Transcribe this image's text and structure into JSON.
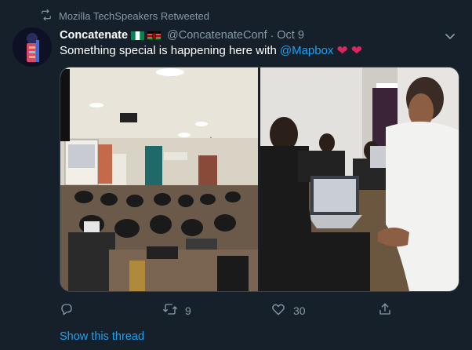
{
  "retweet": {
    "text": "Mozilla TechSpeakers Retweeted",
    "icon": "retweet-icon"
  },
  "author": {
    "name": "Concatenate",
    "flags": [
      "nigeria-flag",
      "kenya-flag"
    ],
    "handle": "@ConcatenateConf",
    "separator": "·",
    "date": "Oct 9"
  },
  "tweet": {
    "text": "Something special is happening here with",
    "mention": "@Mapbox",
    "hearts": [
      "❤",
      "❤"
    ]
  },
  "actions": {
    "reply": {
      "icon": "reply-icon",
      "count": ""
    },
    "retweet": {
      "icon": "retweet-icon",
      "count": "9"
    },
    "like": {
      "icon": "heart-outline-icon",
      "count": "30"
    },
    "share": {
      "icon": "share-icon",
      "count": ""
    }
  },
  "show_thread": "Show this thread",
  "colors": {
    "background": "#15202b",
    "text": "#ffffff",
    "muted": "#8899a6",
    "link": "#1da1f2",
    "heart": "#e0245e"
  }
}
